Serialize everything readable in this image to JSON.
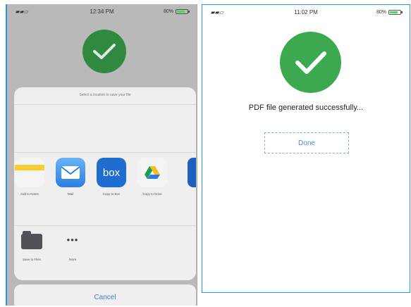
{
  "left": {
    "status": {
      "time": "12:34 PM",
      "battery": "80%",
      "battery_level": 0.8
    },
    "sheet_caption": "Select a location to save your file",
    "apps": [
      {
        "label": "Add to Notes",
        "icon": "notes-icon"
      },
      {
        "label": "Mail",
        "icon": "mail-icon"
      },
      {
        "label": "Copy to Box",
        "icon": "box-icon",
        "text": "box"
      },
      {
        "label": "Copy to Drive",
        "icon": "drive-icon"
      }
    ],
    "actions": [
      {
        "label": "Save to Files",
        "icon": "folder-icon"
      },
      {
        "label": "More",
        "icon": "more-icon",
        "text": "•••"
      }
    ],
    "cancel_label": "Cancel"
  },
  "right": {
    "status": {
      "time": "11:02 PM",
      "battery": "80%",
      "battery_level": 0.8
    },
    "message": "PDF file generated successfully...",
    "done_label": "Done"
  },
  "colors": {
    "success_green": "#3ca84f",
    "ios_blue": "#3c7edc",
    "box_blue": "#1f6dd0"
  }
}
